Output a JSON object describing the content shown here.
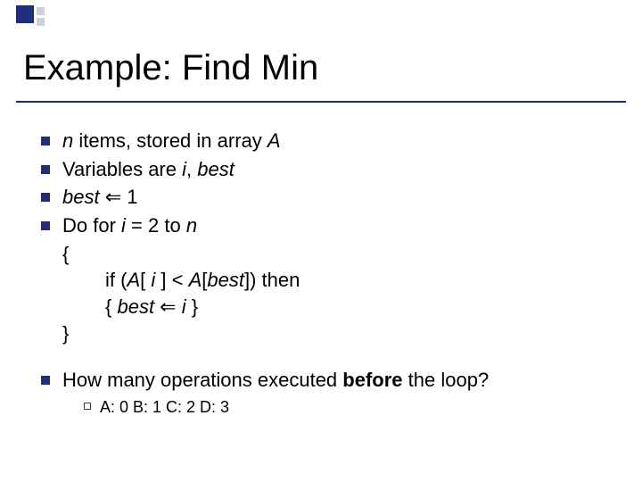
{
  "title": "Example: Find Min",
  "bullets": {
    "b1_pre": "",
    "b1_n": "n",
    "b1_mid": " items, stored in array ",
    "b1_A": "A",
    "b2_pre": "Variables are ",
    "b2_i": "i",
    "b2_sep": ", ",
    "b2_best": "best",
    "b3_best": "best",
    "b3_arrow": " ⇐ ",
    "b3_one": "1",
    "b4_pre": "Do for ",
    "b4_i": "i",
    "b4_mid": " = 2 to ",
    "b4_n": "n",
    "brace_open": "{",
    "if_pre": "if (",
    "if_A1": "A",
    "if_lb1": "[ ",
    "if_i1": "i",
    "if_rb1": " ] < ",
    "if_A2": "A",
    "if_lb2": "[",
    "if_best": "best",
    "if_rb2": "]) then",
    "assign_open": "{ ",
    "assign_best": "best",
    "assign_arrow": " ⇐ ",
    "assign_i": "i",
    "assign_close": " }",
    "brace_close": "}"
  },
  "question": {
    "pre": "How many operations executed ",
    "bold": "before",
    "post": " the loop?"
  },
  "options": "A: 0   B: 1   C: 2   D: 3"
}
